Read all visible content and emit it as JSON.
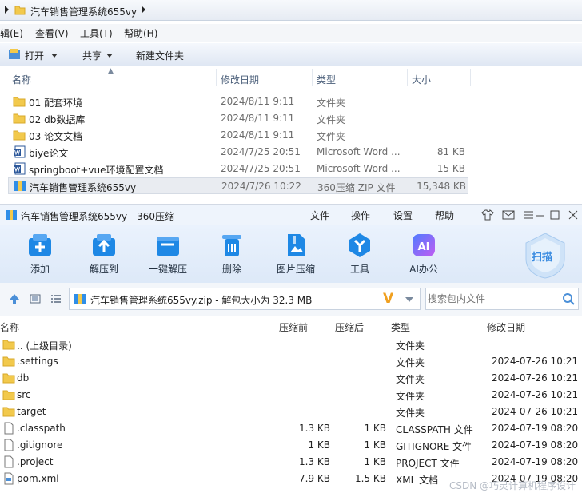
{
  "explorer": {
    "path": "汽车销售管理系统655vy",
    "menu": [
      "辑(E)",
      "查看(V)",
      "工具(T)",
      "帮助(H)"
    ],
    "toolbar": {
      "open": "打开",
      "share": "共享",
      "new_folder": "新建文件夹"
    },
    "columns": {
      "name": "名称",
      "date": "修改日期",
      "type": "类型",
      "size": "大小"
    },
    "files": [
      {
        "name": "01 配套环境",
        "date": "2024/8/11 9:11",
        "type": "文件夹",
        "size": "",
        "icon": "folder-icon"
      },
      {
        "name": "02 db数据库",
        "date": "2024/8/11 9:11",
        "type": "文件夹",
        "size": "",
        "icon": "folder-icon"
      },
      {
        "name": "03 论文文档",
        "date": "2024/8/11 9:11",
        "type": "文件夹",
        "size": "",
        "icon": "folder-icon"
      },
      {
        "name": "biye论文",
        "date": "2024/7/25 20:51",
        "type": "Microsoft Word ...",
        "size": "81 KB",
        "icon": "word-icon"
      },
      {
        "name": "springboot+vue环境配置文档",
        "date": "2024/7/25 20:51",
        "type": "Microsoft Word ...",
        "size": "15 KB",
        "icon": "word-icon"
      },
      {
        "name": "汽车销售管理系统655vy",
        "date": "2024/7/26 10:22",
        "type": "360压缩 ZIP 文件",
        "size": "15,348 KB",
        "icon": "zip-icon",
        "selected": true
      }
    ]
  },
  "zip": {
    "title": "汽车销售管理系统655vy - 360压缩",
    "menu": [
      "文件",
      "操作",
      "设置",
      "帮助"
    ],
    "tools": [
      {
        "label": "添加",
        "icon": "add-icon"
      },
      {
        "label": "解压到",
        "icon": "extract-to-icon"
      },
      {
        "label": "一键解压",
        "icon": "one-click-extract-icon"
      },
      {
        "label": "删除",
        "icon": "delete-icon"
      },
      {
        "label": "图片压缩",
        "icon": "image-compress-icon"
      },
      {
        "label": "工具",
        "icon": "tools-icon"
      },
      {
        "label": "AI办公",
        "icon": "ai-office-icon"
      }
    ],
    "scan_label": "扫描",
    "ai_text": "AI",
    "path_text": "汽车销售管理系统655vy.zip - 解包大小为 32.3 MB",
    "search_placeholder": "搜索包内文件",
    "columns": {
      "name": "名称",
      "packed": "压缩前",
      "compressed": "压缩后",
      "type": "类型",
      "date": "修改日期"
    },
    "rows": [
      {
        "name": ".. (上级目录)",
        "packed": "",
        "compressed": "",
        "type": "文件夹",
        "date": "",
        "icon": "folder-icon"
      },
      {
        "name": ".settings",
        "packed": "",
        "compressed": "",
        "type": "文件夹",
        "date": "2024-07-26 10:21",
        "icon": "folder-icon"
      },
      {
        "name": "db",
        "packed": "",
        "compressed": "",
        "type": "文件夹",
        "date": "2024-07-26 10:21",
        "icon": "folder-icon"
      },
      {
        "name": "src",
        "packed": "",
        "compressed": "",
        "type": "文件夹",
        "date": "2024-07-26 10:21",
        "icon": "folder-icon"
      },
      {
        "name": "target",
        "packed": "",
        "compressed": "",
        "type": "文件夹",
        "date": "2024-07-26 10:21",
        "icon": "folder-icon"
      },
      {
        "name": ".classpath",
        "packed": "1.3 KB",
        "compressed": "1 KB",
        "type": "CLASSPATH 文件",
        "date": "2024-07-19 08:20",
        "icon": "file-icon"
      },
      {
        "name": ".gitignore",
        "packed": "1 KB",
        "compressed": "1 KB",
        "type": "GITIGNORE 文件",
        "date": "2024-07-19 08:20",
        "icon": "file-icon"
      },
      {
        "name": ".project",
        "packed": "1.3 KB",
        "compressed": "1 KB",
        "type": "PROJECT 文件",
        "date": "2024-07-19 08:20",
        "icon": "file-icon"
      },
      {
        "name": "pom.xml",
        "packed": "7.9 KB",
        "compressed": "1.5 KB",
        "type": "XML 文档",
        "date": "2024-07-19 08:20",
        "icon": "xml-file-icon"
      }
    ]
  },
  "watermark": "CSDN @巧灵计算机程序设计",
  "colors": {
    "accent": "#1e88e5",
    "folder": "#f2c94c",
    "zip_blue": "#2f8ee8",
    "selected_row": "#e9ecf1"
  }
}
